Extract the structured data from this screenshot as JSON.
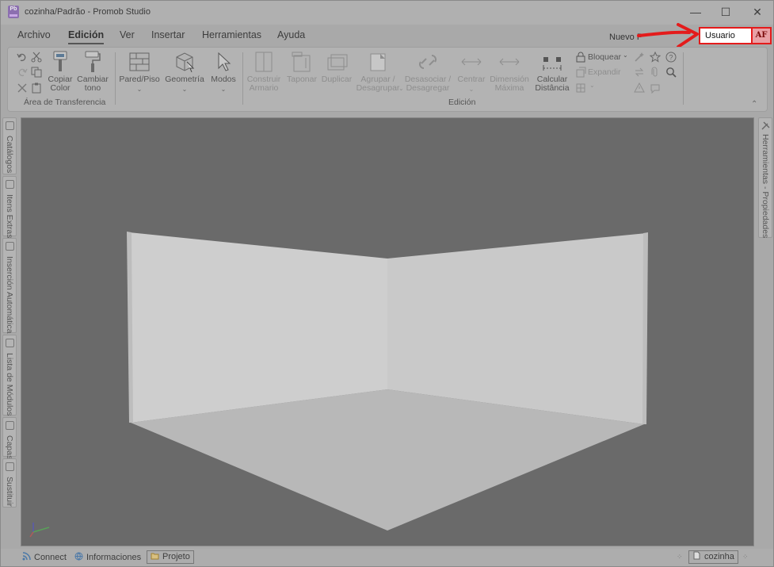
{
  "window": {
    "title": "cozinha/Padrão - Promob Studio",
    "app_icon_text": "Pb",
    "minimize_glyph": "—",
    "maximize_glyph": "☐",
    "close_glyph": "✕"
  },
  "menu": {
    "tabs": [
      {
        "label": "Archivo"
      },
      {
        "label": "Edición"
      },
      {
        "label": "Ver"
      },
      {
        "label": "Insertar"
      },
      {
        "label": "Herramientas"
      },
      {
        "label": "Ayuda"
      }
    ],
    "active_tab": "Edición",
    "nuevo_label": "Nuevo P"
  },
  "user": {
    "name": "Usuario",
    "initials": "AF",
    "highlight_color": "#e41b1b"
  },
  "ribbon": {
    "clipboard": {
      "copy_color": "Copiar\nColor",
      "change_tone": "Cambiar\ntono",
      "group_label": "Área de Transferencia"
    },
    "wall_floor": "Pared/Piso",
    "geometry": "Geometría",
    "modes": "Modos",
    "build_cabinet": "Construir\nArmario",
    "cap": "Taponar",
    "duplicate": "Duplicar",
    "group_ungroup": "Agrupar /\nDesagrupar",
    "dissociate": "Desasociar /\nDesagregar",
    "center": "Centrar",
    "max_dimension": "Dimensión\nMáxima",
    "calc_distance": "Calcular\nDistância",
    "lock": "Bloquear",
    "expand": "Expandir",
    "edit_group_label": "Edición"
  },
  "left_tabs": [
    {
      "label": "Catálogos"
    },
    {
      "label": "Itens Extras"
    },
    {
      "label": "Inserción Automática"
    },
    {
      "label": "Lista de Módulos"
    },
    {
      "label": "Capas"
    },
    {
      "label": "Sustituir"
    }
  ],
  "right_tab": {
    "label": "Herramientas - Propiedades"
  },
  "status": {
    "connect": "Connect",
    "info": "Informaciones",
    "project": "Projeto",
    "file": "cozinha"
  },
  "colors": {
    "viewport_bg": "#6a6a6a",
    "wall": "#cfcfcf",
    "floor": "#b9b9b9",
    "ribbon_bg": "#b3b3b3",
    "highlight": "#e41b1b"
  }
}
